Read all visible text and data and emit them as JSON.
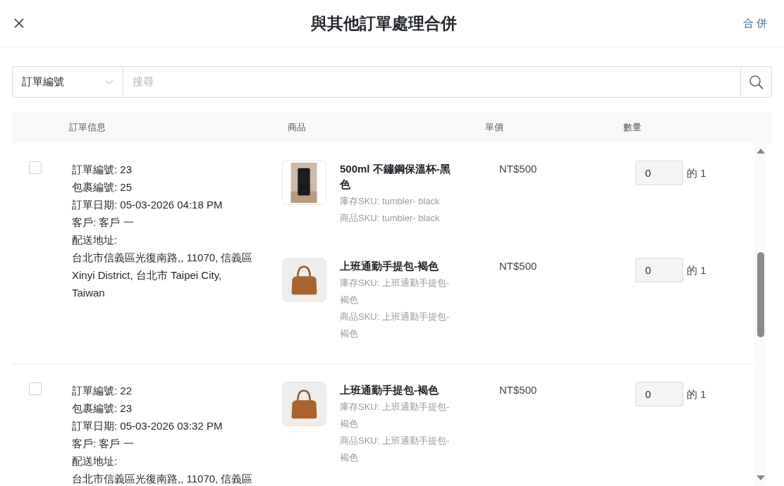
{
  "header": {
    "title": "與其他訂單處理合併",
    "action": "合 併"
  },
  "search": {
    "filter": "訂單編號",
    "placeholder": "搜尋"
  },
  "table": {
    "columns": [
      "訂單信息",
      "商品",
      "單價",
      "數量"
    ],
    "rows": [
      {
        "checked": false,
        "lines": [
          "訂單編號: 23",
          "包裹編號: 25",
          "訂單日期: 05-03-2026 04:18 PM",
          "客戶: 客戶 一",
          "配送地址:"
        ],
        "address": "台北市信義區光復南路,, 11070, 信義區 Xinyi District, 台北市 Taipei City, Taiwan",
        "items": [
          {
            "kind": "tumbler",
            "name": "500ml 不鏽鋼保溫杯-黑色",
            "stock_sku": "庫存SKU: tumbler- black",
            "product_sku": "商品SKU: tumbler- black",
            "price": "NT$500",
            "quantity": "0",
            "of": "的 1"
          },
          {
            "kind": "handbag",
            "name": "上班通勤手提包-褐色",
            "stock_sku": "庫存SKU: 上班通勤手提包-褐色",
            "product_sku": "商品SKU: 上班通勤手提包-褐色",
            "price": "NT$500",
            "quantity": "0",
            "of": "的 1"
          }
        ]
      },
      {
        "checked": false,
        "lines": [
          "訂單編號: 22",
          "包裹編號: 23",
          "訂單日期: 05-03-2026 03:32 PM",
          "客戶: 客戶 一",
          "配送地址:"
        ],
        "address": "台北市信義區光復南路,, 11070, 信義區",
        "items": [
          {
            "kind": "handbag",
            "name": "上班通勤手提包-褐色",
            "stock_sku": "庫存SKU: 上班通勤手提包-褐色",
            "product_sku": "商品SKU: 上班通勤手提包-褐色",
            "price": "NT$500",
            "quantity": "0",
            "of": "的 1"
          }
        ]
      }
    ]
  }
}
